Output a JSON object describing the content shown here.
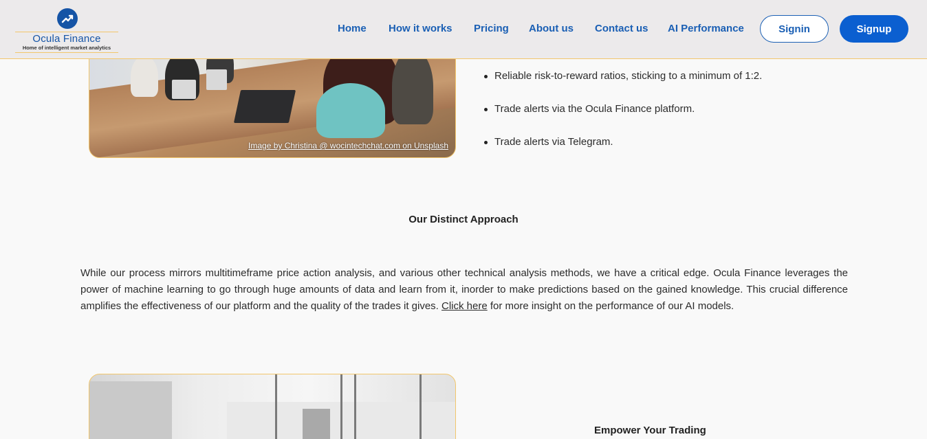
{
  "brand": {
    "name": "Ocula Finance",
    "tagline": "Home of intelligent market analytics",
    "logo_icon": "trend-arrow-icon",
    "brand_color": "#1554a6",
    "accent_color": "#f2c66b"
  },
  "nav": {
    "links": [
      "Home",
      "How it works",
      "Pricing",
      "About us",
      "Contact us",
      "AI Performance"
    ],
    "signin_label": "Signin",
    "signup_label": "Signup"
  },
  "top_section": {
    "image_credit": "Image by Christina @ wocintechchat.com on Unsplash",
    "bullets": [
      "Reliable risk-to-reward ratios, sticking to a minimum of 1:2.",
      "Trade alerts via the Ocula Finance platform.",
      "Trade alerts via Telegram."
    ]
  },
  "approach": {
    "title": "Our Distinct Approach",
    "text_before_link": "While our process mirrors multitimeframe price action analysis, and various other technical analysis methods, we have a critical edge. Ocula Finance leverages the power of machine learning to go through huge amounts of data and learn from it, inorder to make predictions based on the gained knowledge. This crucial difference amplifies the effectiveness of our platform and the quality of the trades it gives. ",
    "link_label": "Click here",
    "text_after_link": " for more insight on the performance of our AI models."
  },
  "empower": {
    "title": "Empower Your Trading"
  }
}
